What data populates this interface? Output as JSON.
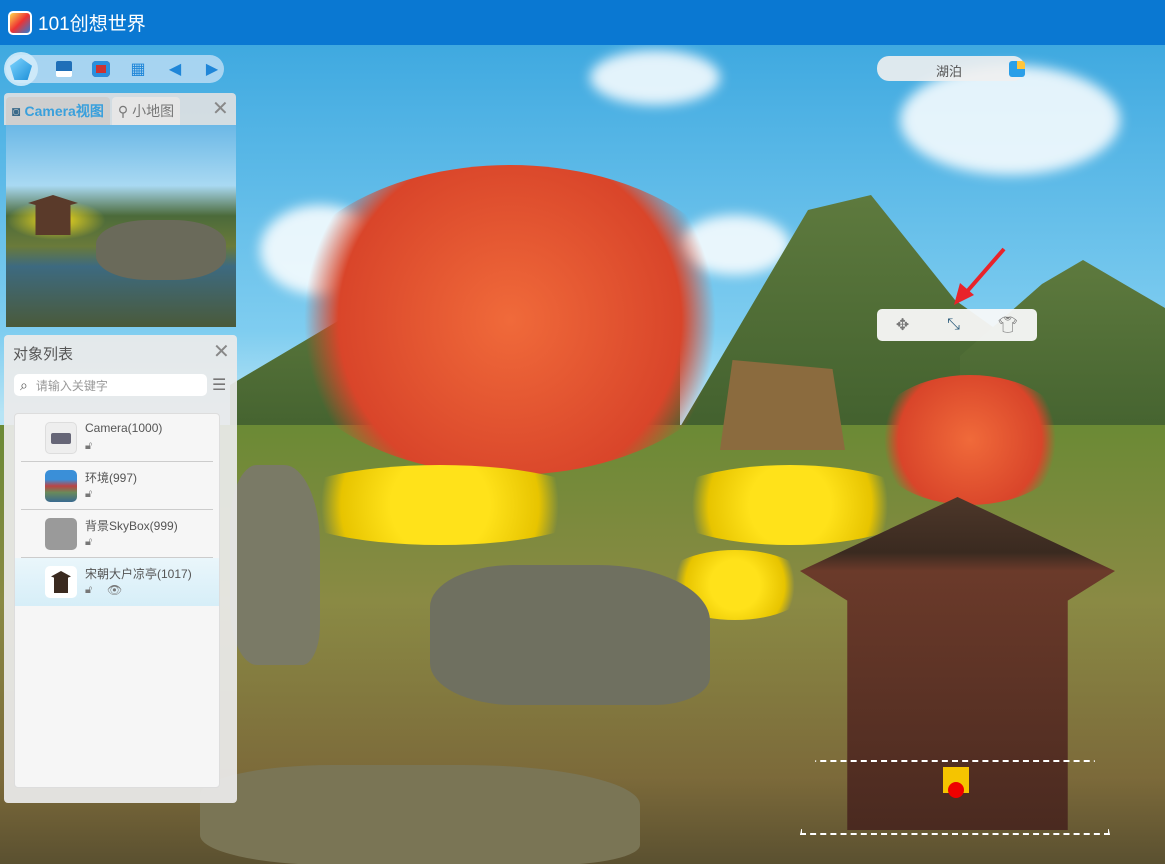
{
  "app": {
    "title": "101创想世界"
  },
  "toolbar": {
    "items": [
      {
        "name": "home-gem",
        "icon": "gem-icon"
      },
      {
        "name": "save",
        "icon": "save-icon"
      },
      {
        "name": "screenshot",
        "icon": "camera-icon"
      },
      {
        "name": "grid",
        "icon": "grid-icon"
      },
      {
        "name": "undo",
        "icon": "undo-icon"
      },
      {
        "name": "redo",
        "icon": "redo-icon"
      }
    ]
  },
  "view_panel": {
    "tabs": [
      {
        "label": "Camera视图",
        "active": true
      },
      {
        "label": "小地图",
        "active": false
      }
    ]
  },
  "object_panel": {
    "title": "对象列表",
    "search_placeholder": "请输入关键字",
    "items": [
      {
        "name": "Camera(1000)",
        "locked": false,
        "selected": false
      },
      {
        "name": "环境(997)",
        "locked": false,
        "selected": false
      },
      {
        "name": "背景SkyBox(999)",
        "locked": false,
        "selected": false
      },
      {
        "name": "宋朝大户凉亭(1017)",
        "locked": false,
        "selected": true,
        "visible": true
      }
    ]
  },
  "scene_selector": {
    "label": "湖泊"
  },
  "gizmo": {
    "tools": [
      "move-icon",
      "scale-shrink-icon",
      "outfit-icon"
    ]
  },
  "colors": {
    "titlebar": "#0a78d2",
    "accent": "#3aa0dc",
    "arrow": "#e8232a"
  }
}
